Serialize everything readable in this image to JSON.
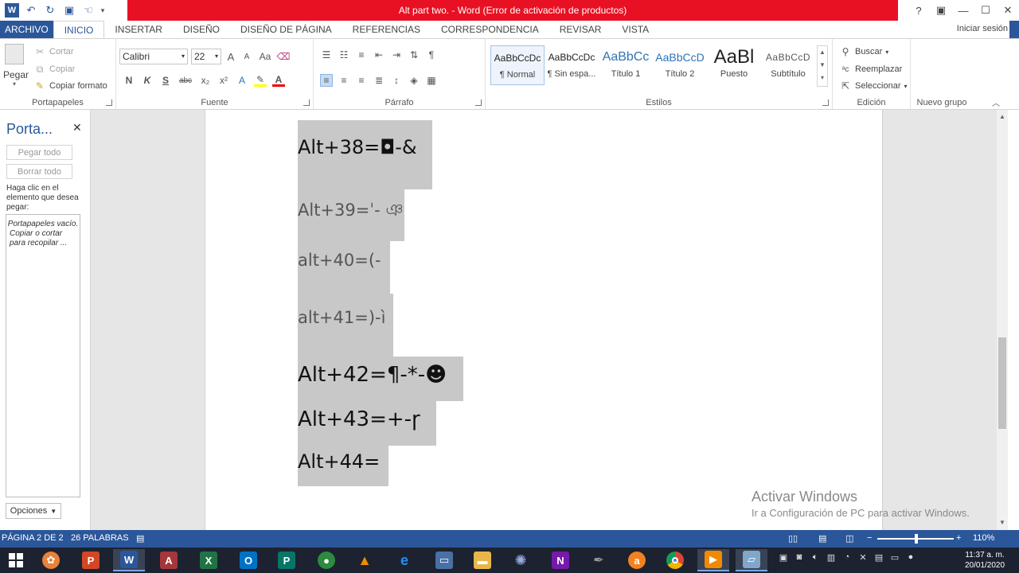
{
  "window": {
    "title": "Alt part two. -  Word (Error de activación de productos)",
    "controls": {
      "help": "?",
      "ribbon_display": "▣",
      "minimize": "—",
      "maximize": "☐",
      "close": "✕"
    }
  },
  "tabs": [
    "ARCHIVO",
    "INICIO",
    "INSERTAR",
    "DISEÑO",
    "DISEÑO DE PÁGINA",
    "REFERENCIAS",
    "CORRESPONDENCIA",
    "REVISAR",
    "VISTA"
  ],
  "signin": "Iniciar sesión",
  "ribbon": {
    "clipboard": {
      "paste": "Pegar",
      "cut": "Cortar",
      "copy": "Copiar",
      "format_painter": "Copiar formato",
      "label": "Portapapeles"
    },
    "font": {
      "name": "Calibri",
      "size": "22",
      "label": "Fuente",
      "grow": "A",
      "shrink": "A",
      "case": "Aa",
      "bold": "N",
      "italic": "K",
      "underline": "S",
      "strike": "abc",
      "sub": "x₂",
      "sup": "x²"
    },
    "paragraph": {
      "label": "Párrafo"
    },
    "styles": {
      "label": "Estilos",
      "items": [
        {
          "sample": "AaBbCcDc",
          "name": "¶ Normal"
        },
        {
          "sample": "AaBbCcDc",
          "name": "¶ Sin espa..."
        },
        {
          "sample": "AaBbCc",
          "name": "Título 1"
        },
        {
          "sample": "AaBbCcD",
          "name": "Título 2"
        },
        {
          "sample": "AaBl",
          "name": "Puesto"
        },
        {
          "sample": "AaBbCcD",
          "name": "Subtítulo"
        }
      ]
    },
    "editing": {
      "find": "Buscar",
      "replace": "Reemplazar",
      "select": "Seleccionar",
      "label": "Edición"
    },
    "new_group": {
      "label": "Nuevo grupo"
    }
  },
  "clipboard_pane": {
    "title": "Porta...",
    "paste_all": "Pegar todo",
    "clear_all": "Borrar todo",
    "help": "Haga clic en el elemento que desea pegar:",
    "empty_1": "Portapapeles vacío.",
    "empty_2": "Copiar o cortar para recopilar ...",
    "options": "Opciones"
  },
  "document": {
    "lines": [
      "Alt+38=◘-&",
      "Alt+39=ˈ- ঞ",
      "alt+40=(-",
      "alt+41=)-ì",
      "Alt+42=¶-*-☻",
      "Alt+43=+-ɼ",
      "Alt+44="
    ]
  },
  "activation": {
    "title": "Activar Windows",
    "subtitle": "Ir a Configuración de PC para activar Windows."
  },
  "status": {
    "page": "PÁGINA 2 DE 2",
    "words": "26 PALABRAS",
    "zoom": "110%",
    "minus": "−",
    "plus": "+"
  },
  "taskbar": {
    "time": "11:37 a. m.",
    "date": "20/01/2020",
    "colors": {
      "powerpoint": "#d24726",
      "word": "#2b579a",
      "access": "#a4373a",
      "excel": "#217346",
      "outlook": "#0072c6",
      "publisher": "#077568",
      "onenote": "#7719aa",
      "avast": "#f48120",
      "vlc": "#f08a00"
    }
  }
}
